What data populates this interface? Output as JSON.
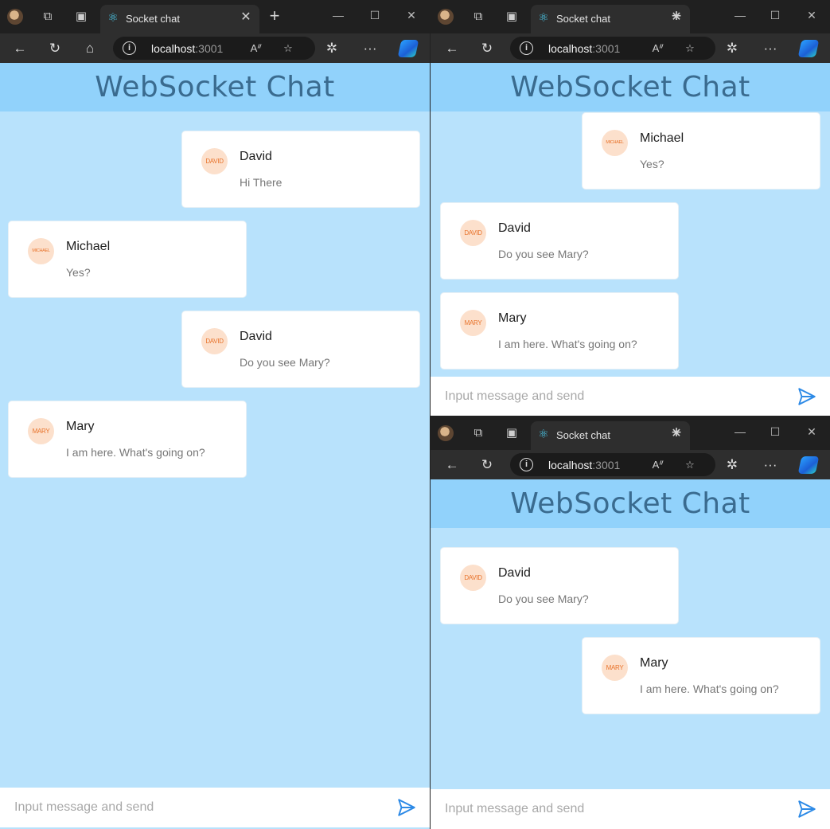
{
  "browser": {
    "tab_title": "Socket chat",
    "url_host": "localhost",
    "url_port": ":3001",
    "new_tab_glyph": "+",
    "close_glyph": "✕"
  },
  "page": {
    "title": "WebSocket Chat",
    "input_placeholder": "Input message and send"
  },
  "windows": {
    "left": {
      "messages": [
        {
          "avatar": "DAVID",
          "name": "David",
          "text": "Hi There"
        },
        {
          "avatar": "MICHAEL",
          "name": "Michael",
          "text": "Yes?"
        },
        {
          "avatar": "DAVID",
          "name": "David",
          "text": "Do you see Mary?"
        },
        {
          "avatar": "MARY",
          "name": "Mary",
          "text": "I am here. What's going on?"
        }
      ]
    },
    "top_right": {
      "messages": [
        {
          "avatar": "MICHAEL",
          "name": "Michael",
          "text": "Yes?"
        },
        {
          "avatar": "DAVID",
          "name": "David",
          "text": "Do you see Mary?"
        },
        {
          "avatar": "MARY",
          "name": "Mary",
          "text": "I am here. What's going on?"
        }
      ]
    },
    "bottom_right": {
      "messages": [
        {
          "avatar": "DAVID",
          "name": "David",
          "text": "Do you see Mary?"
        },
        {
          "avatar": "MARY",
          "name": "Mary",
          "text": "I am here. What's going on?"
        }
      ]
    }
  },
  "colors": {
    "page_bg": "#b8e2fc",
    "header_bg": "#91d2fb",
    "title": "#3a6b8f",
    "avatar_bg": "#fce0cc",
    "avatar_text": "#e8732b",
    "send_icon": "#2d8ae6"
  }
}
